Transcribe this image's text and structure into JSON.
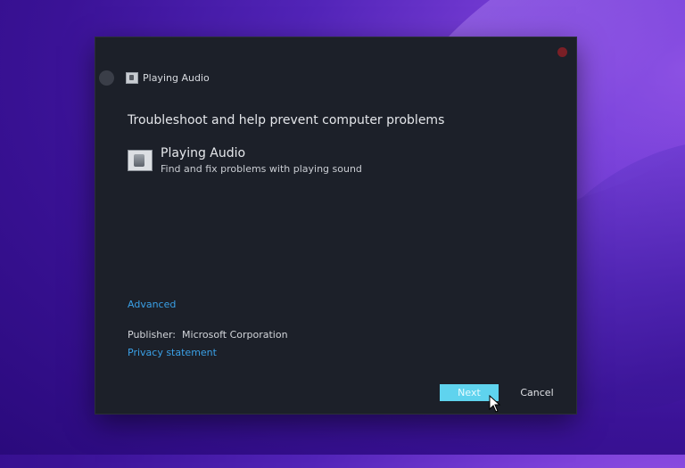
{
  "window": {
    "title": "Playing Audio",
    "title_icon": "speaker-icon",
    "back_icon": "back-arrow-icon",
    "close_icon": "close-icon"
  },
  "content": {
    "heading": "Troubleshoot and help prevent computer problems",
    "item": {
      "icon": "speaker-icon",
      "title": "Playing Audio",
      "description": "Find and fix problems with playing sound"
    },
    "advanced_link": "Advanced",
    "publisher_label": "Publisher:",
    "publisher_value": "Microsoft Corporation",
    "privacy_link": "Privacy statement"
  },
  "buttons": {
    "next": "Next",
    "cancel": "Cancel"
  },
  "colors": {
    "dialog_bg": "#1c2029",
    "link": "#3aa0e6",
    "accent_button": "#5fd3ee",
    "close_dot": "#7a1f26"
  }
}
